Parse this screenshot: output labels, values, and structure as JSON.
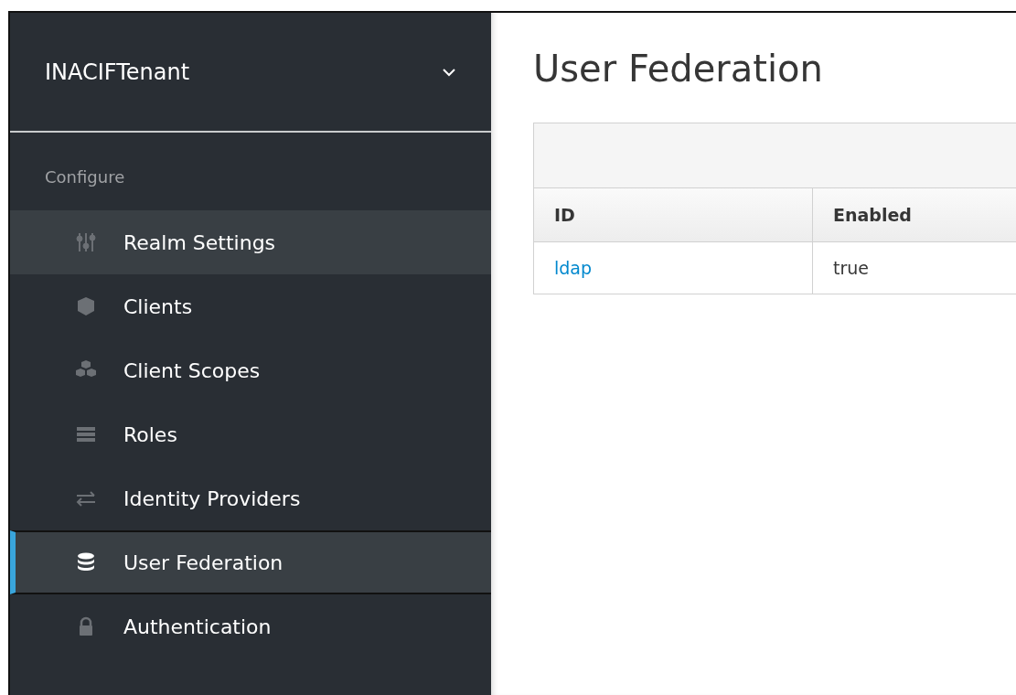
{
  "realm_selector": {
    "label": "INACIFTenant"
  },
  "sidebar": {
    "section_label": "Configure",
    "items": [
      {
        "label": "Realm Settings",
        "selected": false,
        "hovered": true
      },
      {
        "label": "Clients",
        "selected": false,
        "hovered": false
      },
      {
        "label": "Client Scopes",
        "selected": false,
        "hovered": false
      },
      {
        "label": "Roles",
        "selected": false,
        "hovered": false
      },
      {
        "label": "Identity Providers",
        "selected": false,
        "hovered": false
      },
      {
        "label": "User Federation",
        "selected": true,
        "hovered": false
      },
      {
        "label": "Authentication",
        "selected": false,
        "hovered": false
      }
    ]
  },
  "page_title": "User Federation",
  "table": {
    "columns": [
      "ID",
      "Enabled"
    ],
    "rows": [
      {
        "cells": [
          {
            "text": "ldap",
            "kind": "link"
          },
          {
            "text": "true",
            "kind": "text"
          }
        ]
      }
    ]
  }
}
